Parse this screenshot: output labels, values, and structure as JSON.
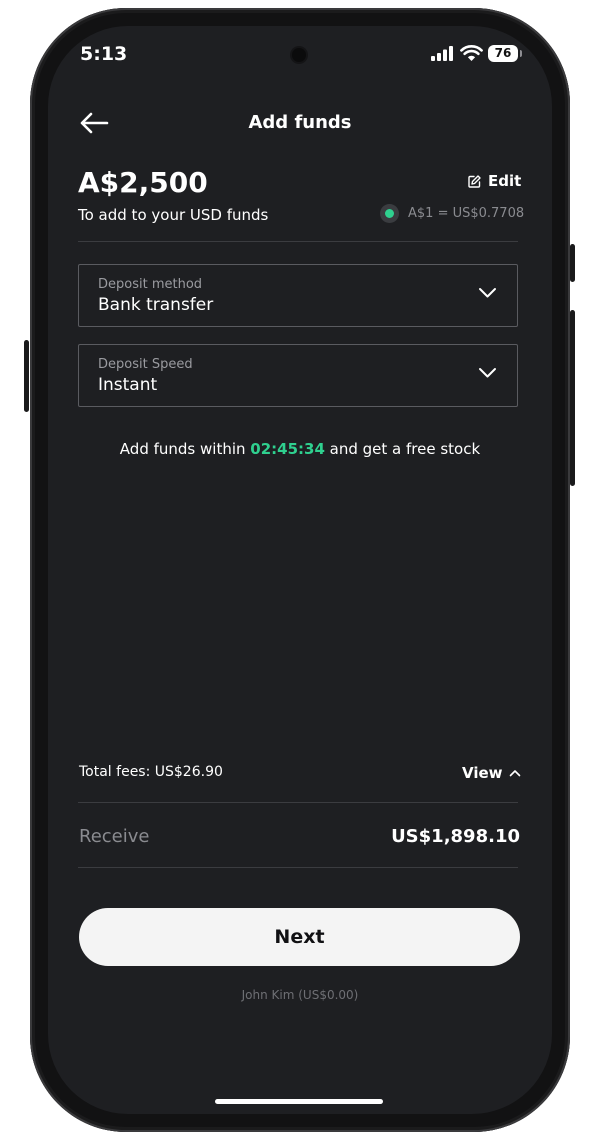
{
  "status_bar": {
    "time": "5:13",
    "battery": "76",
    "signal_icon": "cellular-signal-icon",
    "wifi_icon": "wifi-icon",
    "battery_icon": "battery-icon"
  },
  "header": {
    "title": "Add funds",
    "back_icon": "arrow-left-icon"
  },
  "summary": {
    "amount": "A$2,500",
    "subtitle": "To add to your USD funds",
    "edit_label": "Edit",
    "edit_icon": "pencil-icon",
    "rate": "A$1 = US$0.7708"
  },
  "deposit_method": {
    "label": "Deposit method",
    "value": "Bank transfer"
  },
  "deposit_speed": {
    "label": "Deposit Speed",
    "value": "Instant"
  },
  "promo": {
    "prefix": "Add funds within ",
    "timer": "02:45:34",
    "suffix": " and get a free stock"
  },
  "fees": {
    "label": "Total fees: US$26.90",
    "view_label": "View"
  },
  "receive": {
    "label": "Receive",
    "value": "US$1,898.10"
  },
  "actions": {
    "next_label": "Next"
  },
  "footnote": {
    "name": "John Kim (US$0.00)"
  },
  "colors": {
    "background": "#1e1f22",
    "accent_green": "#2fd08f",
    "text_primary": "#ffffff",
    "text_secondary": "#8a8b90",
    "button_background": "#f4f4f4"
  }
}
